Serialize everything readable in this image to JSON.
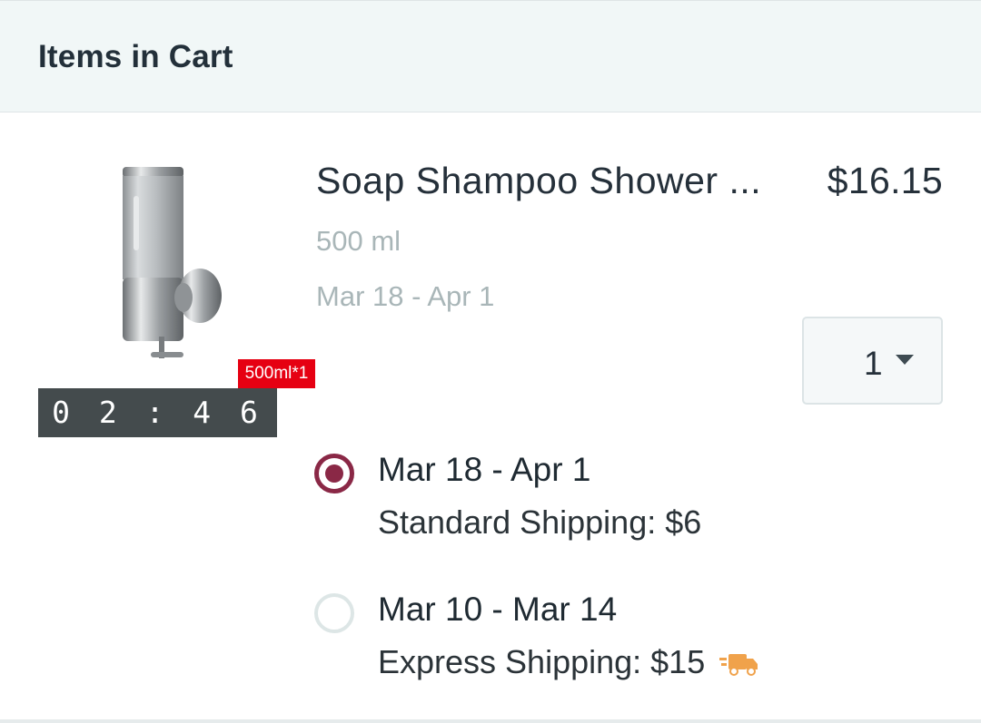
{
  "header": {
    "title": "Items in Cart"
  },
  "item": {
    "name": "Soap Shampoo Shower ...",
    "price": "$16.15",
    "variant": "500 ml",
    "estimated_delivery": "Mar 18 - Apr 1",
    "image": {
      "icon": "soap-dispenser-image",
      "size_tag": "500ml*1",
      "timer": "0 2 : 4 6"
    },
    "quantity": "1"
  },
  "shipping_options": [
    {
      "date": "Mar 18 - Apr 1",
      "method": "Standard Shipping: $6",
      "selected": true
    },
    {
      "date": "Mar 10 - Mar 14",
      "method": "Express Shipping: $15",
      "selected": false,
      "icon": "truck-icon"
    }
  ],
  "colors": {
    "accent": "#8a2846",
    "tag_red": "#e60012",
    "truck": "#f0a24b"
  }
}
